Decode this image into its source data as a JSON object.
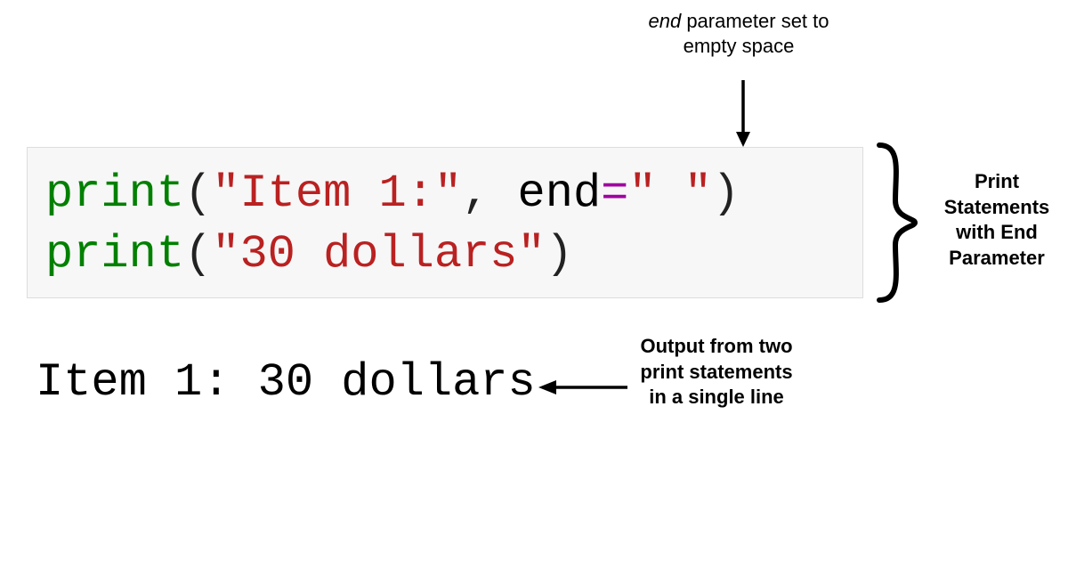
{
  "annotations": {
    "top": {
      "em_word": "end",
      "rest": " parameter set to empty space"
    },
    "right": "Print Statements with End Parameter",
    "output": "Output from two print statements in a single line"
  },
  "code": {
    "line1": {
      "fn": "print",
      "open": "(",
      "str": "\"Item 1:\"",
      "sep": ", ",
      "kw": "end",
      "eq": "=",
      "val": "\" \"",
      "close": ")"
    },
    "line2": {
      "fn": "print",
      "open": "(",
      "str": "\"30 dollars\"",
      "close": ")"
    }
  },
  "output_text": "Item 1: 30 dollars",
  "colors": {
    "function": "#008000",
    "string": "#ba2121",
    "operator": "#a000a0",
    "code_bg": "#f7f7f7",
    "text": "#000000"
  }
}
